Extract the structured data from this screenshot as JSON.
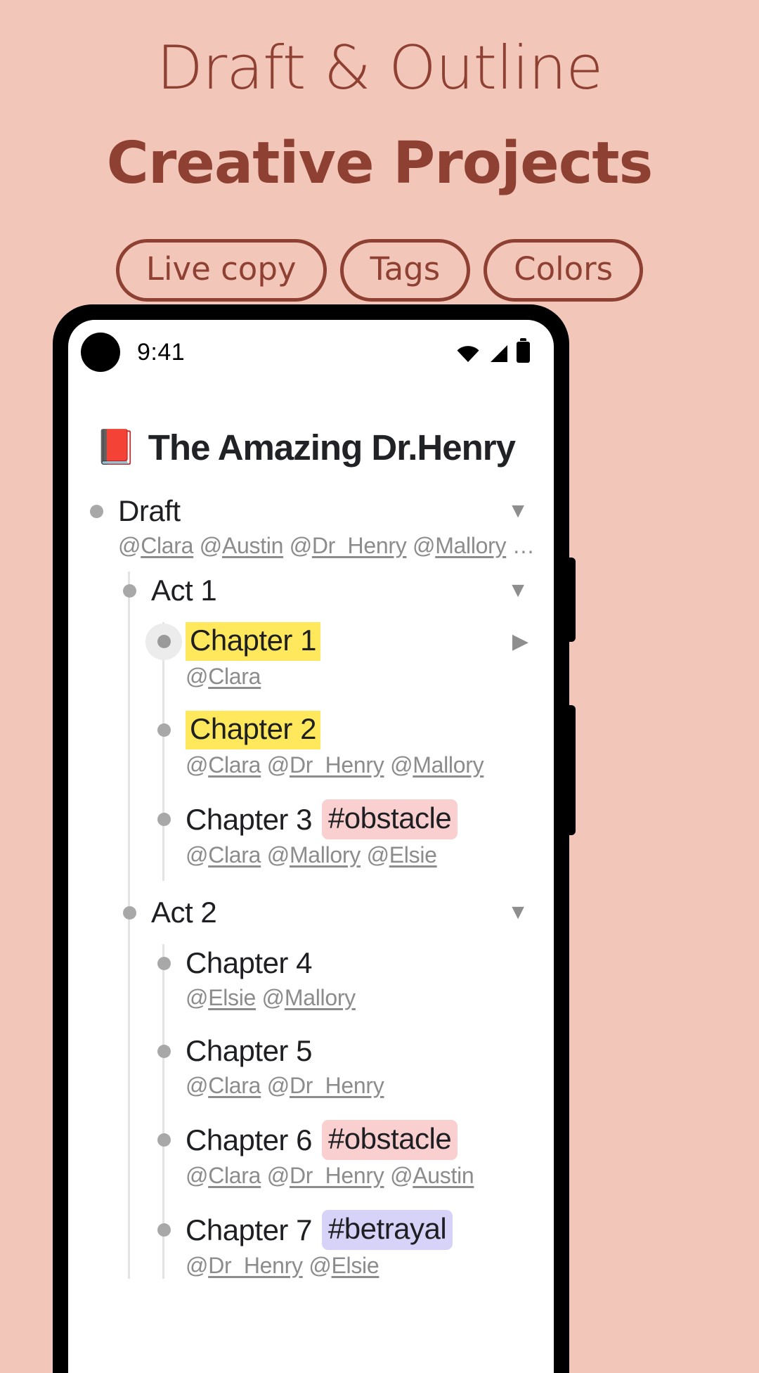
{
  "promo": {
    "line1": "Draft & Outline",
    "line2": "Creative Projects",
    "pills": [
      {
        "label": "Live copy"
      },
      {
        "label": "Tags"
      },
      {
        "label": "Colors"
      }
    ],
    "background_color": "#f2c6b9",
    "accent_color": "#8e4032"
  },
  "phone": {
    "status_bar": {
      "time": "9:41",
      "icons": [
        "wifi-icon",
        "cellular-signal-icon",
        "battery-icon"
      ]
    }
  },
  "document": {
    "emoji": "📕",
    "title": "The Amazing Dr.Henry"
  },
  "outline": {
    "colors": {
      "highlight_yellow": "#ffe85c",
      "tag_obstacle": "#f9cfd0",
      "tag_betrayal": "#d7d2f7",
      "bullet": "#a8a8a8",
      "mention_text": "#8c8c8c"
    },
    "nodes": [
      {
        "id": "draft",
        "level": 0,
        "label": "Draft",
        "highlight": false,
        "tag": null,
        "caret": "▼",
        "selected": false,
        "mentions": [
          "@Clara",
          "@Austin",
          "@Dr_Henry",
          "@Mallory"
        ],
        "mentions_overflow": "…"
      },
      {
        "id": "act1",
        "level": 1,
        "label": "Act 1",
        "highlight": false,
        "tag": null,
        "caret": "▼",
        "selected": false,
        "mentions": [],
        "mentions_overflow": ""
      },
      {
        "id": "chapter1",
        "level": 2,
        "label": "Chapter 1",
        "highlight": true,
        "tag": null,
        "caret": "▶",
        "selected": true,
        "mentions": [
          "@Clara"
        ],
        "mentions_overflow": ""
      },
      {
        "id": "chapter2",
        "level": 2,
        "label": "Chapter 2",
        "highlight": true,
        "tag": null,
        "caret": "",
        "selected": false,
        "mentions": [
          "@Clara",
          "@Dr_Henry",
          "@Mallory"
        ],
        "mentions_overflow": ""
      },
      {
        "id": "chapter3",
        "level": 2,
        "label": "Chapter 3",
        "highlight": false,
        "tag": "#obstacle",
        "tag_style": "obstacle",
        "caret": "",
        "selected": false,
        "mentions": [
          "@Clara",
          "@Mallory",
          "@Elsie"
        ],
        "mentions_overflow": ""
      },
      {
        "id": "act2",
        "level": 1,
        "label": "Act 2",
        "highlight": false,
        "tag": null,
        "caret": "▼",
        "selected": false,
        "mentions": [],
        "mentions_overflow": ""
      },
      {
        "id": "chapter4",
        "level": 2,
        "label": "Chapter 4",
        "highlight": false,
        "tag": null,
        "caret": "",
        "selected": false,
        "mentions": [
          "@Elsie",
          "@Mallory"
        ],
        "mentions_overflow": ""
      },
      {
        "id": "chapter5",
        "level": 2,
        "label": "Chapter 5",
        "highlight": false,
        "tag": null,
        "caret": "",
        "selected": false,
        "mentions": [
          "@Clara",
          "@Dr_Henry"
        ],
        "mentions_overflow": ""
      },
      {
        "id": "chapter6",
        "level": 2,
        "label": "Chapter 6",
        "highlight": false,
        "tag": "#obstacle",
        "tag_style": "obstacle",
        "caret": "",
        "selected": false,
        "mentions": [
          "@Clara",
          "@Dr_Henry",
          "@Austin"
        ],
        "mentions_overflow": ""
      },
      {
        "id": "chapter7",
        "level": 2,
        "label": "Chapter 7",
        "highlight": false,
        "tag": "#betrayal",
        "tag_style": "betrayal",
        "caret": "",
        "selected": false,
        "mentions": [
          "@Dr_Henry",
          "@Elsie"
        ],
        "mentions_overflow": ""
      }
    ]
  }
}
